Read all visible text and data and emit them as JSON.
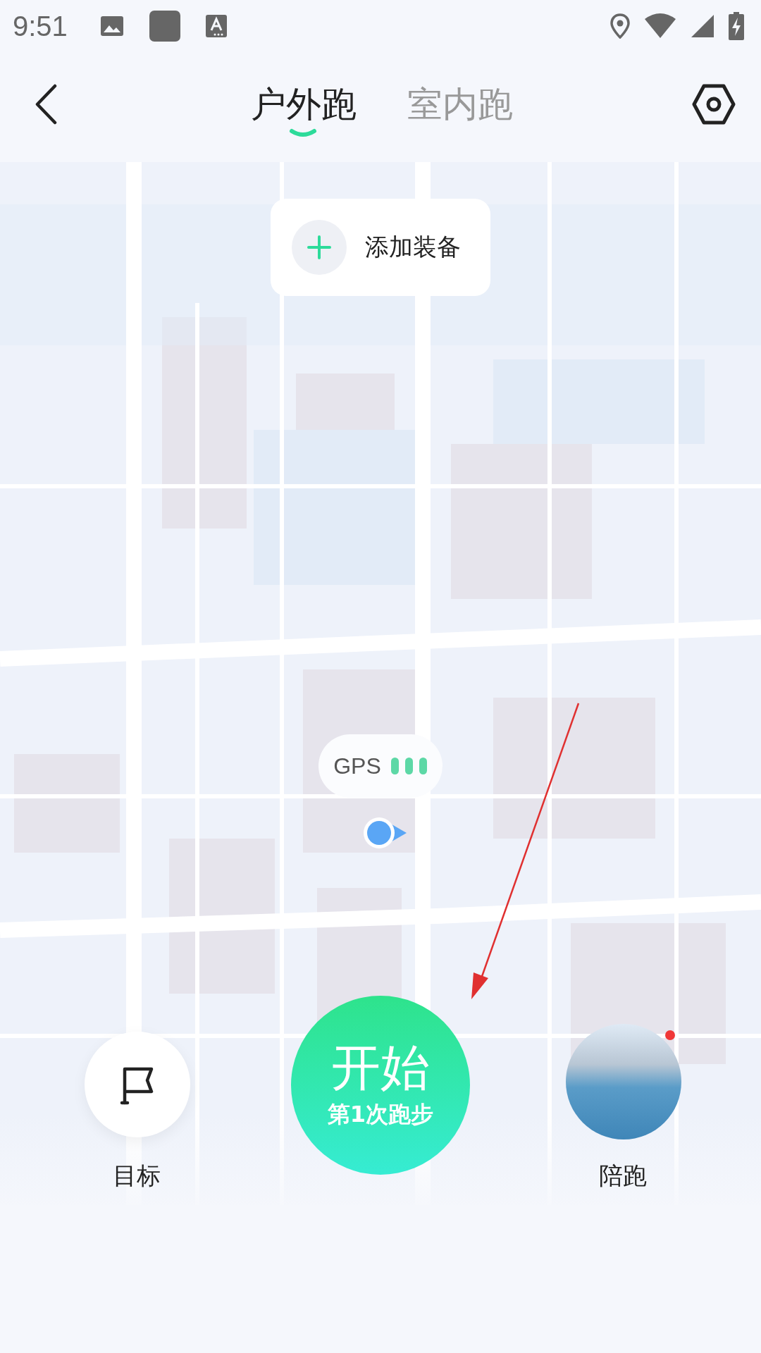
{
  "status_bar": {
    "time": "9:51"
  },
  "tabs": [
    {
      "label": "户外跑",
      "selected": true
    },
    {
      "label": "室内跑",
      "selected": false
    }
  ],
  "add_equipment": {
    "label": "添加装备"
  },
  "gps": {
    "label": "GPS"
  },
  "goal": {
    "label": "目标"
  },
  "start": {
    "title": "开始",
    "subtitle": "第1次跑步"
  },
  "companion": {
    "label": "陪跑",
    "notification_dot": true
  }
}
